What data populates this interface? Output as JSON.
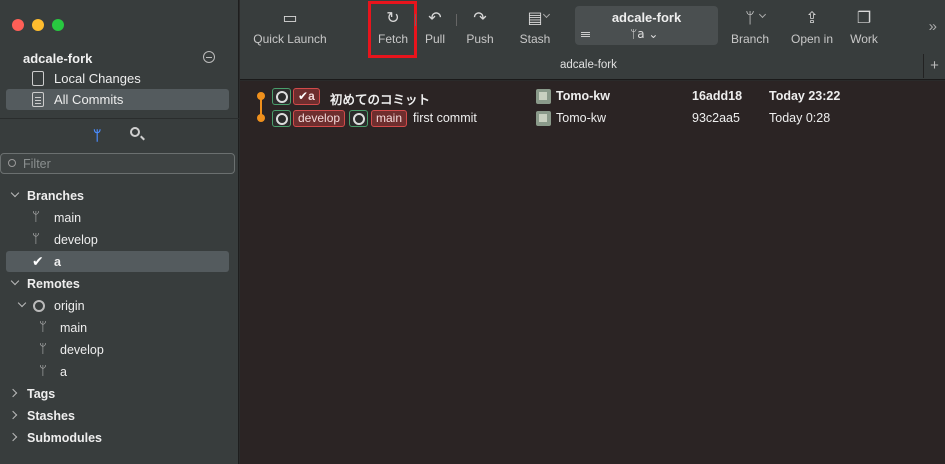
{
  "window": {
    "repo_name": "adcale-fork"
  },
  "sidebar": {
    "nav": [
      {
        "label": "Local Changes",
        "icon": "local-changes-icon",
        "selected": false
      },
      {
        "label": "All Commits",
        "icon": "all-commits-icon",
        "selected": true
      }
    ],
    "filter_placeholder": "Filter",
    "sections": {
      "branches_label": "Branches",
      "branches": [
        {
          "label": "main",
          "current": false
        },
        {
          "label": "develop",
          "current": false
        },
        {
          "label": "a",
          "current": true
        }
      ],
      "remotes_label": "Remotes",
      "origin_label": "origin",
      "remote_branches": [
        "main",
        "develop",
        "a"
      ],
      "tags_label": "Tags",
      "stashes_label": "Stashes",
      "submodules_label": "Submodules"
    }
  },
  "toolbar": {
    "quick_launch": "Quick Launch",
    "fetch": "Fetch",
    "pull": "Pull",
    "push": "Push",
    "stash": "Stash",
    "repo_title": "adcale-fork",
    "repo_branch": "a",
    "branch": "Branch",
    "open_in": "Open in",
    "work": "Work",
    "tab_title": "adcale-fork",
    "plus": "+",
    "overflow": "»"
  },
  "commits": [
    {
      "message": "初めてのコミット",
      "tags": [
        "a"
      ],
      "author": "Tomo-kw",
      "hash": "16add18",
      "date": "Today 23:22",
      "bold": true
    },
    {
      "message": "first commit",
      "tags": [
        "develop",
        "main"
      ],
      "author": "Tomo-kw",
      "hash": "93c2aa5",
      "date": "Today 0:28",
      "bold": false
    }
  ],
  "colors": {
    "accent_highlight": "#e8141c",
    "graph": "#f0901c",
    "tag_fill": "#6e2e2e",
    "tag_border": "#d24a4a"
  }
}
